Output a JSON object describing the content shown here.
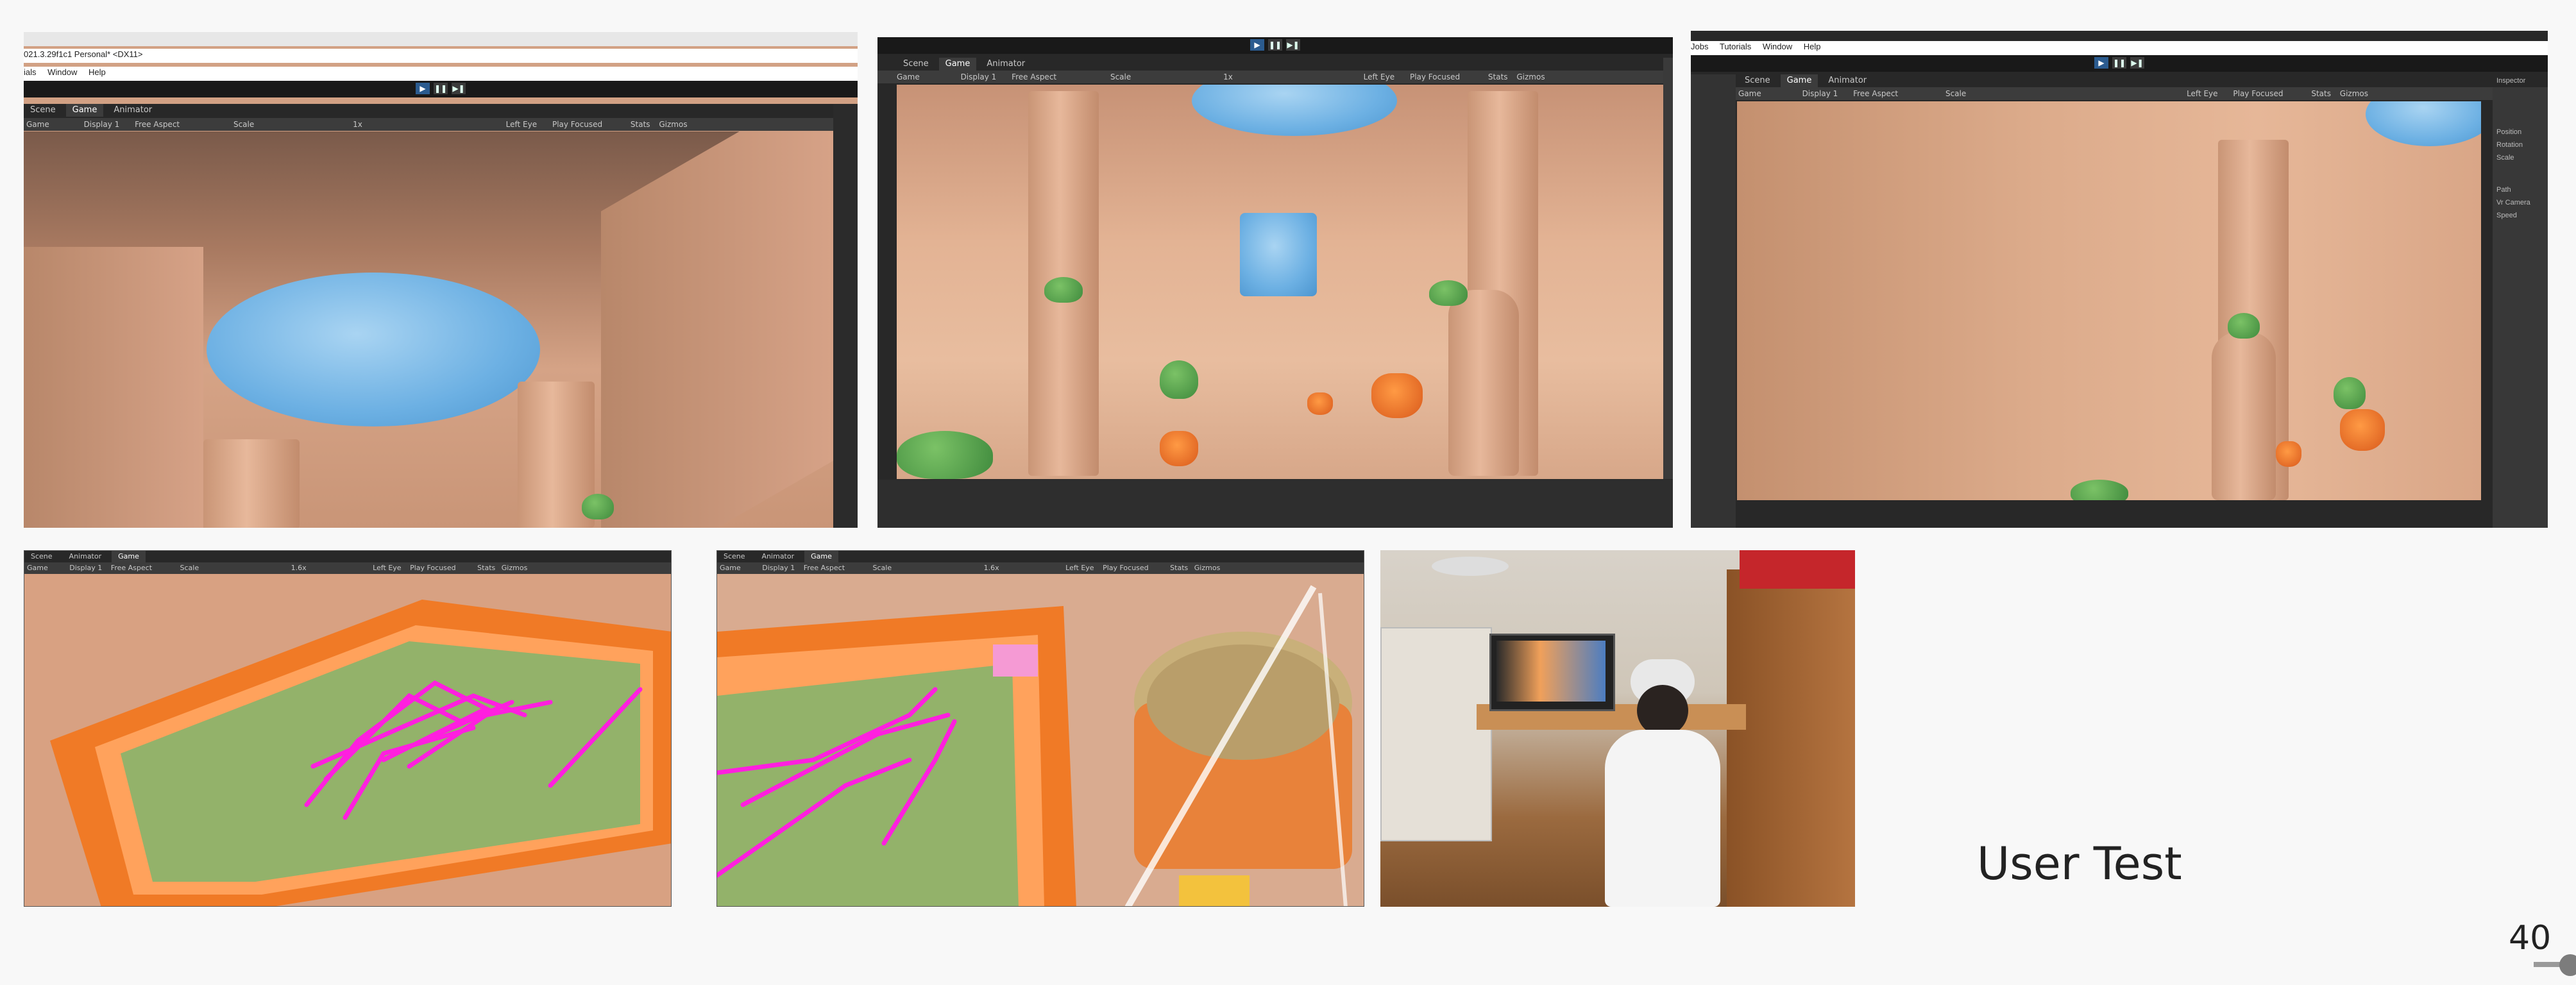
{
  "slide": {
    "caption": "User Test",
    "page_number": "40"
  },
  "shot1": {
    "title_text": "021.3.29f1c1 Personal* <DX11>",
    "menu": [
      "ials",
      "Window",
      "Help"
    ],
    "tabs": [
      "Scene",
      "Game",
      "Animator"
    ],
    "bar": {
      "game": "Game",
      "display": "Display 1",
      "aspect": "Free Aspect",
      "scale_label": "Scale",
      "scale_value": "1x",
      "eye": "Left Eye",
      "play": "Play Focused",
      "stats": "Stats",
      "gizmos": "Gizmos"
    }
  },
  "shot2": {
    "tabs": [
      "Scene",
      "Game",
      "Animator"
    ],
    "bar": {
      "game": "Game",
      "display": "Display 1",
      "aspect": "Free Aspect",
      "scale_label": "Scale",
      "scale_value": "1x",
      "eye": "Left Eye",
      "play": "Play Focused",
      "stats": "Stats",
      "gizmos": "Gizmos"
    }
  },
  "shot3": {
    "menu": [
      "Jobs",
      "Tutorials",
      "Window",
      "Help"
    ],
    "tabs": [
      "Scene",
      "Game",
      "Animator"
    ],
    "bar": {
      "game": "Game",
      "display": "Display 1",
      "aspect": "Free Aspect",
      "scale_label": "Scale",
      "eye": "Left Eye",
      "play": "Play Focused",
      "stats": "Stats",
      "gizmos": "Gizmos"
    },
    "inspector": {
      "title": "Inspector",
      "rows": [
        "Position",
        "Rotation",
        "Scale",
        "Path",
        "Vr Camera",
        "Speed"
      ]
    }
  },
  "shot4": {
    "tabs": [
      "Scene",
      "Animator",
      "Game"
    ],
    "bar": {
      "game": "Game",
      "display": "Display 1",
      "aspect": "Free Aspect",
      "scale_label": "Scale",
      "scale_value": "1.6x",
      "eye": "Left Eye",
      "play": "Play Focused",
      "stats": "Stats",
      "gizmos": "Gizmos"
    }
  },
  "shot5": {
    "tabs": [
      "Scene",
      "Animator",
      "Game"
    ],
    "bar": {
      "game": "Game",
      "display": "Display 1",
      "aspect": "Free Aspect",
      "scale_label": "Scale",
      "scale_value": "1.6x",
      "eye": "Left Eye",
      "play": "Play Focused",
      "stats": "Stats",
      "gizmos": "Gizmos"
    }
  },
  "colors": {
    "editor_dark": "#282828",
    "desert": "#d9a283",
    "sky": "#6cb0e3",
    "magenta": "#ff1fdf",
    "grass": "#93b26a",
    "frame": "#f07a26"
  }
}
